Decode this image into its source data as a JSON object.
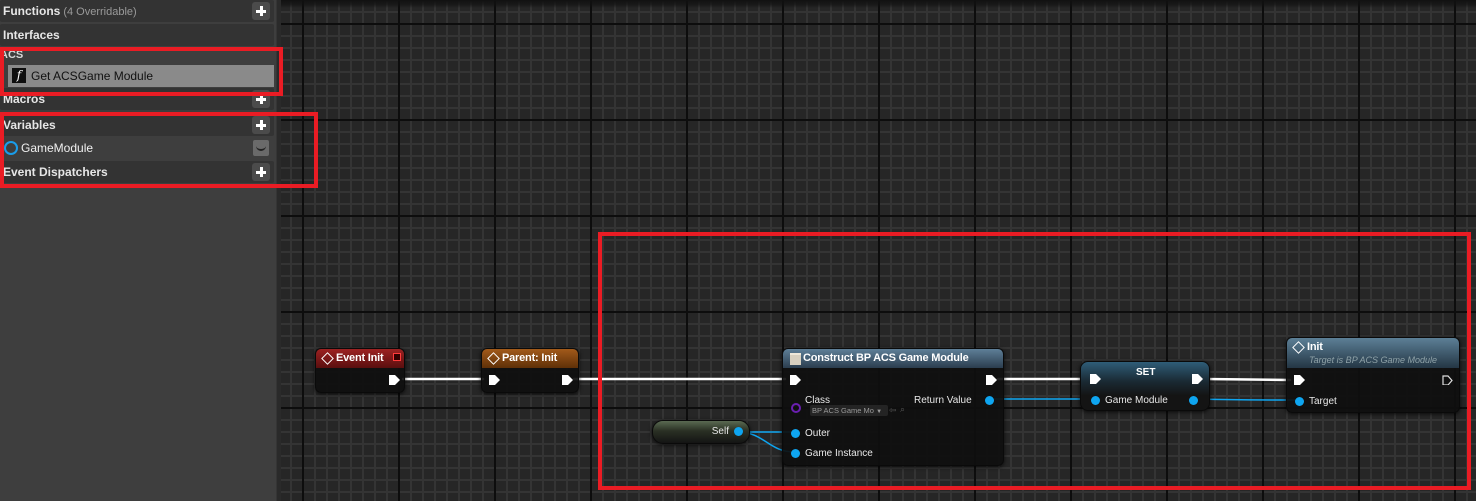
{
  "panel": {
    "functions": {
      "label": "Functions",
      "sub": "(4 Overridable)"
    },
    "interfaces": {
      "label": "Interfaces",
      "category": "ACS",
      "items": [
        {
          "label": "Get ACSGame Module",
          "icon": "function-icon"
        }
      ]
    },
    "macros": {
      "label": "Macros"
    },
    "variables": {
      "label": "Variables",
      "items": [
        {
          "label": "GameModule",
          "icon": "object-variable-icon",
          "color": "#1a9dea"
        }
      ]
    },
    "event_dispatchers": {
      "label": "Event Dispatchers"
    }
  },
  "graph": {
    "nodes": {
      "event_init": {
        "title": "Event Init",
        "header_color": "#8a1a1a"
      },
      "parent_init": {
        "title": "Parent: Init",
        "header_color": "#8a4a12"
      },
      "construct": {
        "title": "Construct BP ACS Game Module",
        "class_label": "Class",
        "class_value": "BP ACS Game Mo",
        "outer_label": "Outer",
        "game_instance_label": "Game Instance",
        "return_label": "Return Value"
      },
      "self": {
        "title": "Self"
      },
      "set": {
        "title": "SET",
        "pin_label": "Game Module"
      },
      "init": {
        "title": "Init",
        "subtitle": "Target is BP ACS Game Module",
        "target_label": "Target"
      }
    },
    "colors": {
      "exec_wire": "#ffffff",
      "object_wire": "#0ea5f0",
      "highlight": "#ea1c24"
    }
  }
}
